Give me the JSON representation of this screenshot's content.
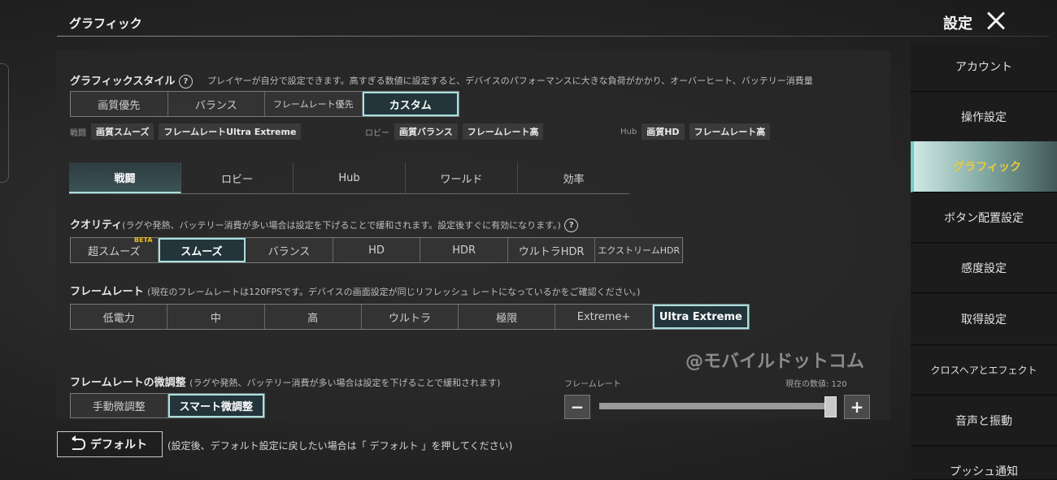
{
  "header": {
    "title": "グラフィック",
    "settings_label": "設定"
  },
  "graphics_style": {
    "title": "グラフィックスタイル",
    "help": "?",
    "description": "プレイヤーが自分で設定できます。高すぎる数値に設定すると、デバイスのパフォーマンスに大きな負荷がかかり、オーバーヒート、バッテリー消費量",
    "options": [
      "画質優先",
      "バランス",
      "フレームレート優先",
      "カスタム"
    ],
    "selected": "カスタム"
  },
  "presets": {
    "battle": {
      "label": "戦闘",
      "tags": [
        "画質スムーズ",
        "フレームレートUltra Extreme"
      ]
    },
    "lobby": {
      "label": "ロビー",
      "tags": [
        "画質バランス",
        "フレームレート高"
      ]
    },
    "hub": {
      "label": "Hub",
      "tags": [
        "画質HD",
        "フレームレート高"
      ]
    }
  },
  "subtabs": [
    "戦闘",
    "ロビー",
    "Hub",
    "ワールド",
    "効率"
  ],
  "quality": {
    "title": "クオリティ",
    "note": "(ラグや発熱、バッテリー消費が多い場合は設定を下げることで緩和されます。設定後すぐに有効になります。)",
    "help": "?",
    "options": [
      "超スムーズ",
      "スムーズ",
      "バランス",
      "HD",
      "HDR",
      "ウルトラHDR",
      "エクストリームHDR"
    ],
    "beta_badge": "BETA",
    "selected": "スムーズ"
  },
  "framerate": {
    "title": "フレームレート",
    "note": "(現在のフレームレートは120FPSです。デバイスの画面設定が同じリフレッシュ レートになっているかをご確認ください。)",
    "options": [
      "低電力",
      "中",
      "高",
      "ウルトラ",
      "極限",
      "Extreme+",
      "Ultra Extreme"
    ],
    "selected": "Ultra Extreme"
  },
  "fine_tune": {
    "title": "フレームレートの微調整",
    "note": "(ラグや発熱、バッテリー消費が多い場合は設定を下げることで緩和されます)",
    "options": [
      "手動微調整",
      "スマート微調整"
    ],
    "selected": "スマート微調整",
    "slider_label": "フレームレート",
    "current_value_label": "現在の数値: 120",
    "minus": "−",
    "plus": "+"
  },
  "watermark": "@モバイルドットコム",
  "footer": {
    "default_label": "デフォルト",
    "default_note": "(設定後、デフォルト設定に戻したい場合は「 デフォルト 」を押してください)"
  },
  "menu": {
    "items": [
      "アカウント",
      "操作設定",
      "グラフィック",
      "ボタン配置設定",
      "感度設定",
      "取得設定",
      "クロスヘアとエフェクト",
      "音声と振動",
      "プッシュ通知"
    ],
    "active": "グラフィック"
  },
  "colors": {
    "accent": "#a8e0e0",
    "menu_active_text": "#e8cc3a",
    "beta": "#e8c020"
  }
}
